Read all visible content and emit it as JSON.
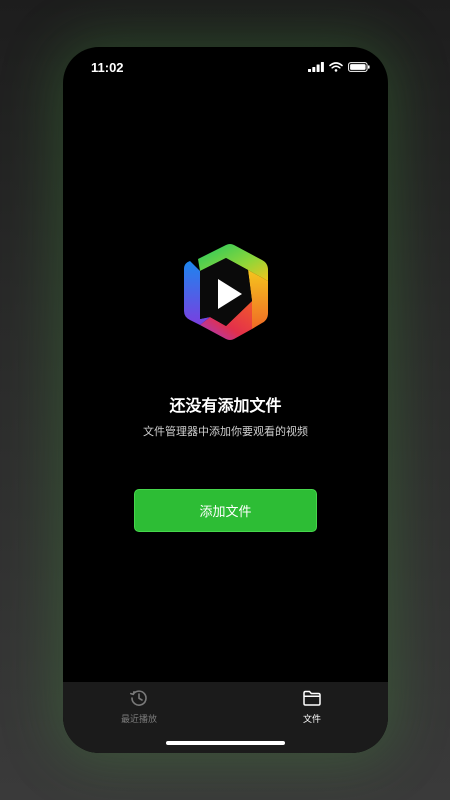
{
  "status_bar": {
    "time": "11:02",
    "icons": [
      "cellular-signal-icon",
      "wifi-icon",
      "battery-icon"
    ]
  },
  "app_logo": {
    "icon": "play-logo-icon",
    "colors": [
      "#2fc24a",
      "#f5c21f",
      "#f0582a",
      "#e0324a",
      "#8a3cd6",
      "#1f7ff0"
    ]
  },
  "empty_state": {
    "title": "还没有添加文件",
    "subtitle": "文件管理器中添加你要观看的视频",
    "button_label": "添加文件"
  },
  "tab_bar": {
    "tabs": [
      {
        "label": "最近播放",
        "icon": "history-icon",
        "active": false
      },
      {
        "label": "文件",
        "icon": "folder-icon",
        "active": true
      }
    ]
  },
  "colors": {
    "accent": "#2dbd35",
    "screen_background": "#000000",
    "tab_bar_background": "#1b1b1b",
    "inactive_tab": "#7a7a7a"
  }
}
